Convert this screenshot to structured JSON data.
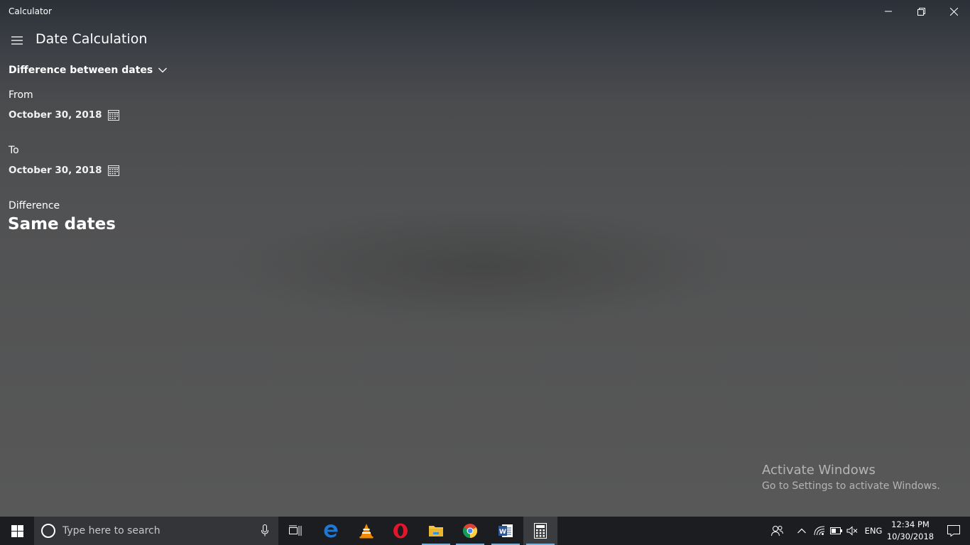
{
  "window": {
    "title": "Calculator",
    "controls": {
      "minimize": "minimize",
      "restore": "restore",
      "close": "close"
    }
  },
  "header": {
    "menu_icon": "hamburger-menu-icon",
    "title": "Date Calculation"
  },
  "mode": {
    "selected": "Difference between dates",
    "icon": "chevron-down-icon"
  },
  "from": {
    "label": "From",
    "date": "October 30, 2018",
    "icon": "calendar-icon"
  },
  "to": {
    "label": "To",
    "date": "October 30, 2018",
    "icon": "calendar-icon"
  },
  "difference": {
    "label": "Difference",
    "value": "Same dates"
  },
  "watermark": {
    "title": "Activate Windows",
    "subtitle": "Go to Settings to activate Windows."
  },
  "taskbar": {
    "search_placeholder": "Type here to search",
    "apps": [
      "task-view",
      "edge",
      "vlc",
      "opera",
      "file-explorer",
      "chrome",
      "word",
      "calculator"
    ],
    "tray": {
      "language": "ENG",
      "time": "12:34 PM",
      "date": "10/30/2018"
    }
  },
  "colors": {
    "edge": "#1e78d6",
    "vlc": "#f08a00",
    "opera": "#e4162b",
    "folder": "#f6c343",
    "word": "#2b5797",
    "running_indicator": "#7fb0d8"
  }
}
